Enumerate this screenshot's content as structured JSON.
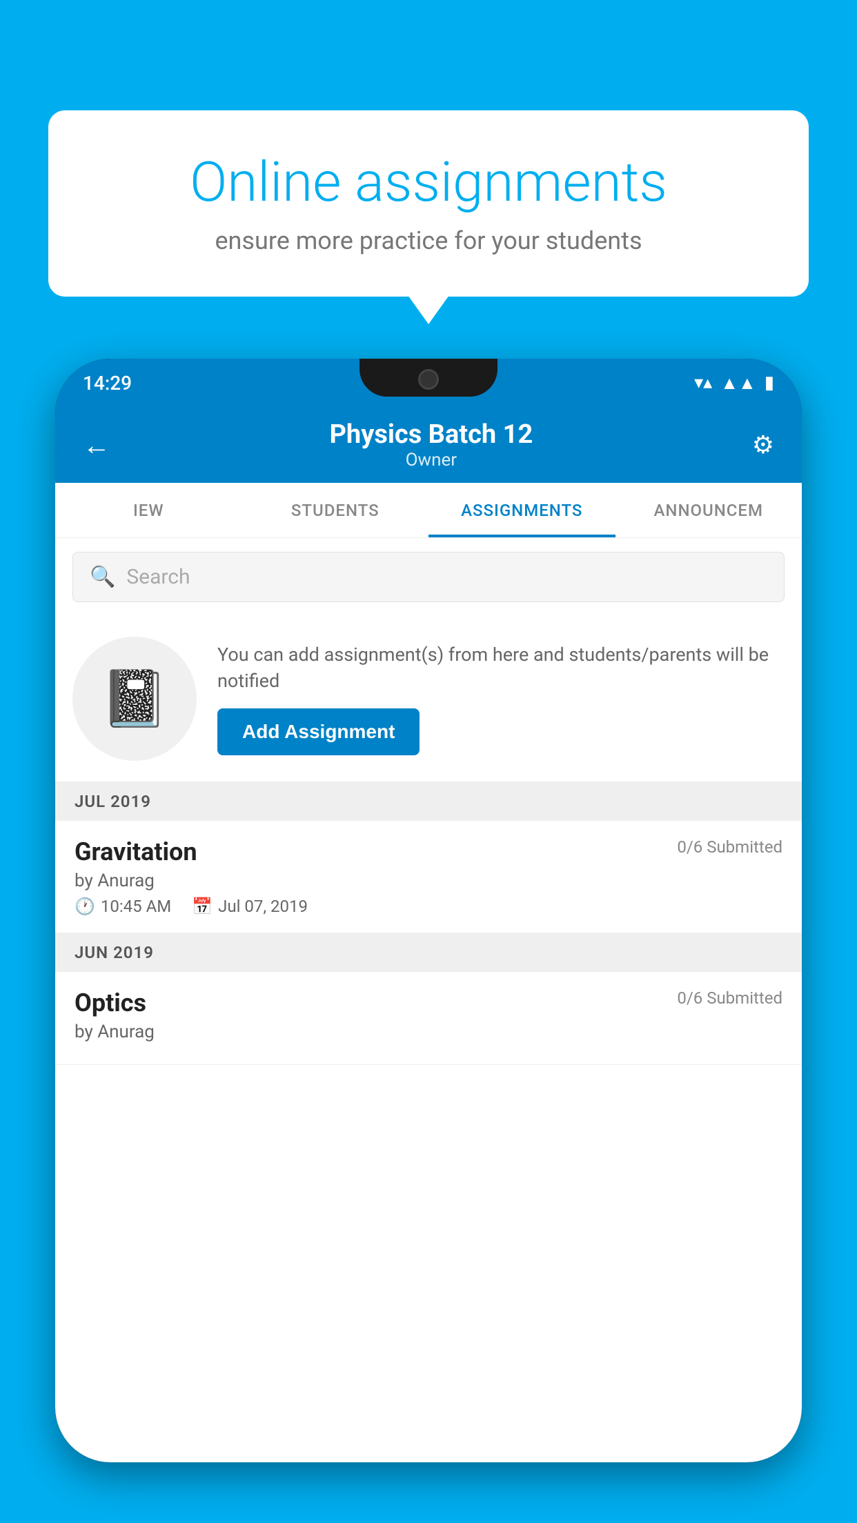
{
  "background_color": "#00AEEF",
  "speech_bubble": {
    "title": "Online assignments",
    "subtitle": "ensure more practice for your students"
  },
  "phone": {
    "status_bar": {
      "time": "14:29",
      "icons": [
        "wifi",
        "signal",
        "battery"
      ]
    },
    "header": {
      "title": "Physics Batch 12",
      "subtitle": "Owner",
      "back_label": "←",
      "settings_label": "⚙"
    },
    "tabs": [
      {
        "label": "IEW",
        "active": false
      },
      {
        "label": "STUDENTS",
        "active": false
      },
      {
        "label": "ASSIGNMENTS",
        "active": true
      },
      {
        "label": "ANNOUNCEM",
        "active": false
      }
    ],
    "search": {
      "placeholder": "Search"
    },
    "empty_state": {
      "description": "You can add assignment(s) from here and students/parents will be notified",
      "button_label": "Add Assignment"
    },
    "sections": [
      {
        "header": "JUL 2019",
        "assignments": [
          {
            "title": "Gravitation",
            "submitted": "0/6 Submitted",
            "author": "by Anurag",
            "time": "10:45 AM",
            "date": "Jul 07, 2019"
          }
        ]
      },
      {
        "header": "JUN 2019",
        "assignments": [
          {
            "title": "Optics",
            "submitted": "0/6 Submitted",
            "author": "by Anurag",
            "time": "",
            "date": ""
          }
        ]
      }
    ]
  }
}
